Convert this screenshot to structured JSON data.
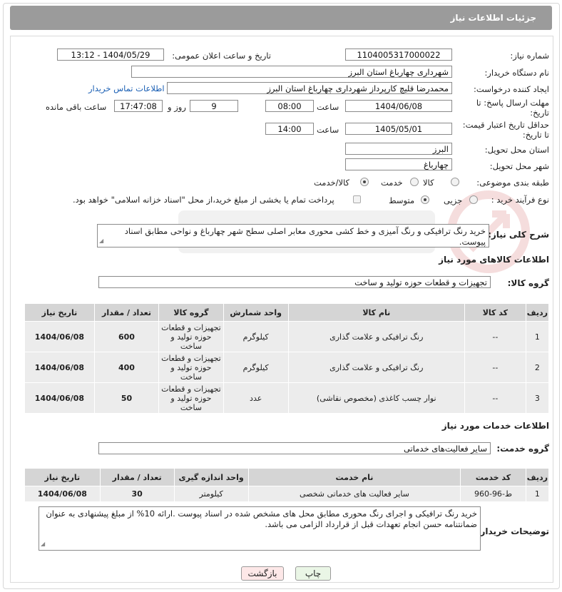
{
  "header": {
    "title": "جزئیات اطلاعات نیاز"
  },
  "fields": {
    "need_number": {
      "label": "شماره نیاز:",
      "value": "1104005317000022"
    },
    "announce_datetime": {
      "label": "تاریخ و ساعت اعلان عمومی:",
      "value": "1404/05/29 - 13:12"
    },
    "buyer_org": {
      "label": "نام دستگاه خریدار:",
      "value": "شهرداری چهارباغ استان البرز"
    },
    "creator": {
      "label": "ایجاد کننده درخواست:",
      "value": "محمدرضا قلیچ کارپرداز شهرداری چهارباغ استان البرز",
      "contact_link": "اطلاعات تماس خریدار"
    },
    "reply_deadline": {
      "label": "مهلت ارسال پاسخ: تا تاریخ:",
      "date": "1404/06/08",
      "time_label": "ساعت",
      "time": "08:00",
      "days": "9",
      "days_label": "روز و",
      "remaining": "17:47:08",
      "remaining_label": "ساعت باقی مانده"
    },
    "price_validity": {
      "label": "حداقل تاریخ اعتبار قیمت: تا تاریخ:",
      "date": "1405/05/01",
      "time_label": "ساعت",
      "time": "14:00"
    },
    "delivery_province": {
      "label": "استان محل تحویل:",
      "value": "البرز"
    },
    "delivery_city": {
      "label": "شهر محل تحویل:",
      "value": "چهارباغ"
    },
    "category": {
      "label": "طبقه بندی موضوعی:",
      "options": [
        "کالا",
        "خدمت",
        "کالا/خدمت"
      ],
      "selected": "کالا/خدمت"
    },
    "purchase_type": {
      "label": "نوع فرآیند خرید :",
      "options": [
        "جزیی",
        "متوسط"
      ],
      "selected": "متوسط",
      "note": "پرداخت تمام یا بخشی از مبلغ خرید،از محل \"اسناد خزانه اسلامی\" خواهد بود."
    }
  },
  "summary": {
    "label": "شرح کلی نیاز:",
    "text": "خرید رنگ ترافیکی و  رنگ آمیزی و خط کشی محوری معابر اصلی سطح شهر چهارباغ و نواحی مطابق اسناد پیوست."
  },
  "goods": {
    "section_title": "اطلاعات کالاهای مورد نیاز",
    "group_label": "گروه کالا:",
    "group_value": "تجهیزات و قطعات حوزه تولید و ساخت",
    "columns": [
      "ردیف",
      "کد کالا",
      "نام کالا",
      "واحد شمارش",
      "گروه کالا",
      "تعداد / مقدار",
      "تاریخ نیاز"
    ],
    "rows": [
      {
        "idx": "1",
        "code": "--",
        "name": "رنگ ترافیکی و علامت گذاری",
        "unit": "کیلوگرم",
        "group": "تجهیزات و قطعات حوزه تولید و ساخت",
        "qty": "600",
        "date": "1404/06/08"
      },
      {
        "idx": "2",
        "code": "--",
        "name": "رنگ ترافیکی و علامت گذاری",
        "unit": "کیلوگرم",
        "group": "تجهیزات و قطعات حوزه تولید و ساخت",
        "qty": "400",
        "date": "1404/06/08"
      },
      {
        "idx": "3",
        "code": "--",
        "name": "نوار چسب کاغذی (مخصوص نقاشی)",
        "unit": "عدد",
        "group": "تجهیزات و قطعات حوزه تولید و ساخت",
        "qty": "50",
        "date": "1404/06/08"
      }
    ]
  },
  "services": {
    "section_title": "اطلاعات خدمات مورد نیاز",
    "group_label": "گروه خدمت:",
    "group_value": "سایر فعالیت‌های خدماتی",
    "columns": [
      "ردیف",
      "کد خدمت",
      "نام خدمت",
      "واحد اندازه گیری",
      "تعداد / مقدار",
      "تاریخ نیاز"
    ],
    "rows": [
      {
        "idx": "1",
        "code": "ط-96-960",
        "name": "سایر فعالیت های خدماتی شخصی",
        "unit": "کیلومتر",
        "qty": "30",
        "date": "1404/06/08"
      }
    ]
  },
  "buyer_notes": {
    "label": "توضیحات خریدار:",
    "text": "خرید رنگ ترافیکی و اجرای رنگ محوری مطابق محل های مشخص شده در اسناد پیوست .ارائه 10% از مبلغ پیشنهادی به عنوان ضمانتنامه حسن انجام تعهدات قبل از قرارداد الزامی می باشد."
  },
  "buttons": {
    "print": "چاپ",
    "back": "بازگشت"
  }
}
